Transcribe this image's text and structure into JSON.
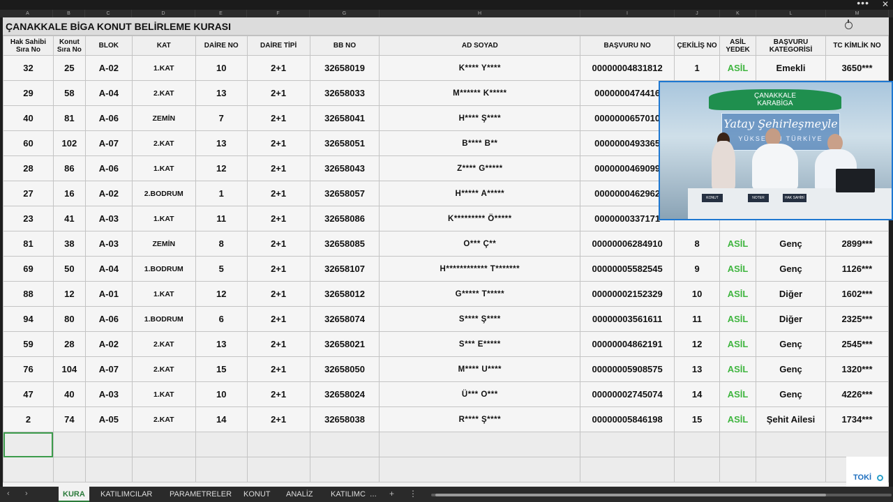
{
  "window": {
    "menu_icon": "•••",
    "close_icon": "✕"
  },
  "col_letters": [
    "A",
    "B",
    "C",
    "D",
    "E",
    "F",
    "G",
    "H",
    "I",
    "J",
    "K",
    "L",
    "M"
  ],
  "sheet": {
    "title": "ÇANAKKALE BİGA KONUT BELİRLEME KURASI",
    "headers": [
      "Hak Sahibi Sıra No",
      "Konut Sıra No",
      "BLOK",
      "KAT",
      "DAİRE NO",
      "DAİRE TİPİ",
      "BB NO",
      "AD SOYAD",
      "BAŞVURU NO",
      "ÇEKİLİŞ NO",
      "ASİL YEDEK",
      "BAŞVURU KATEGORİSİ",
      "TC KİMLİK NO"
    ],
    "rows": [
      [
        "32",
        "25",
        "A-02",
        "1.KAT",
        "10",
        "2+1",
        "32658019",
        "K**** Y****",
        "00000004831812",
        "1",
        "ASİL",
        "Emekli",
        "3650***"
      ],
      [
        "29",
        "58",
        "A-04",
        "2.KAT",
        "13",
        "2+1",
        "32658033",
        "M****** K*****",
        "0000000474416",
        "",
        "",
        "",
        ""
      ],
      [
        "40",
        "81",
        "A-06",
        "ZEMİN",
        "7",
        "2+1",
        "32658041",
        "H**** Ş****",
        "0000000657010",
        "",
        "",
        "",
        ""
      ],
      [
        "60",
        "102",
        "A-07",
        "2.KAT",
        "13",
        "2+1",
        "32658051",
        "B**** B**",
        "0000000493365",
        "",
        "",
        "",
        ""
      ],
      [
        "28",
        "86",
        "A-06",
        "1.KAT",
        "12",
        "2+1",
        "32658043",
        "Z**** G*****",
        "0000000469099",
        "",
        "",
        "",
        ""
      ],
      [
        "27",
        "16",
        "A-02",
        "2.BODRUM",
        "1",
        "2+1",
        "32658057",
        "H***** A*****",
        "0000000462962",
        "",
        "",
        "",
        ""
      ],
      [
        "23",
        "41",
        "A-03",
        "1.KAT",
        "11",
        "2+1",
        "32658086",
        "K********* Ö*****",
        "0000000337171",
        "",
        "",
        "",
        ""
      ],
      [
        "81",
        "38",
        "A-03",
        "ZEMİN",
        "8",
        "2+1",
        "32658085",
        "O*** Ç**",
        "00000006284910",
        "8",
        "ASİL",
        "Genç",
        "2899***"
      ],
      [
        "69",
        "50",
        "A-04",
        "1.BODRUM",
        "5",
        "2+1",
        "32658107",
        "H************ T*******",
        "00000005582545",
        "9",
        "ASİL",
        "Genç",
        "1126***"
      ],
      [
        "88",
        "12",
        "A-01",
        "1.KAT",
        "12",
        "2+1",
        "32658012",
        "G***** T*****",
        "00000002152329",
        "10",
        "ASİL",
        "Diğer",
        "1602***"
      ],
      [
        "94",
        "80",
        "A-06",
        "1.BODRUM",
        "6",
        "2+1",
        "32658074",
        "S**** Ş****",
        "00000003561611",
        "11",
        "ASİL",
        "Diğer",
        "2325***"
      ],
      [
        "59",
        "28",
        "A-02",
        "2.KAT",
        "13",
        "2+1",
        "32658021",
        "S*** E*****",
        "00000004862191",
        "12",
        "ASİL",
        "Genç",
        "2545***"
      ],
      [
        "76",
        "104",
        "A-07",
        "2.KAT",
        "15",
        "2+1",
        "32658050",
        "M**** U****",
        "00000005908575",
        "13",
        "ASİL",
        "Genç",
        "1320***"
      ],
      [
        "47",
        "40",
        "A-03",
        "1.KAT",
        "10",
        "2+1",
        "32658024",
        "Ü*** O***",
        "00000002745074",
        "14",
        "ASİL",
        "Genç",
        "4226***"
      ],
      [
        "2",
        "74",
        "A-05",
        "2.KAT",
        "14",
        "2+1",
        "32658038",
        "R**** Ş****",
        "00000005846198",
        "15",
        "ASİL",
        "Şehit Ailesi",
        "1734***"
      ]
    ]
  },
  "video": {
    "banner_line1": "ÇANAKKALE",
    "banner_line2": "KARABİGA",
    "slogan": "Yatay Şehirleşmeyle",
    "slogan2": "YÜKSELEN TÜRKİYE",
    "tags": [
      "KONUT",
      "NOTER",
      "HAK SAHİBİ"
    ]
  },
  "logo": {
    "text": "TOKİ"
  },
  "tabs": {
    "active": "KURA",
    "items": [
      "KATILIMCILAR",
      "PARAMETRELER",
      "KONUT",
      "ANALİZ",
      "KATILIMC"
    ],
    "nav_prev": "‹",
    "nav_next": "›",
    "overflow": "...",
    "add": "+",
    "more": "⋮"
  },
  "colors": {
    "asil": "#3fb53f",
    "accent": "#2a7a3a",
    "video_border": "#1d77d1"
  }
}
